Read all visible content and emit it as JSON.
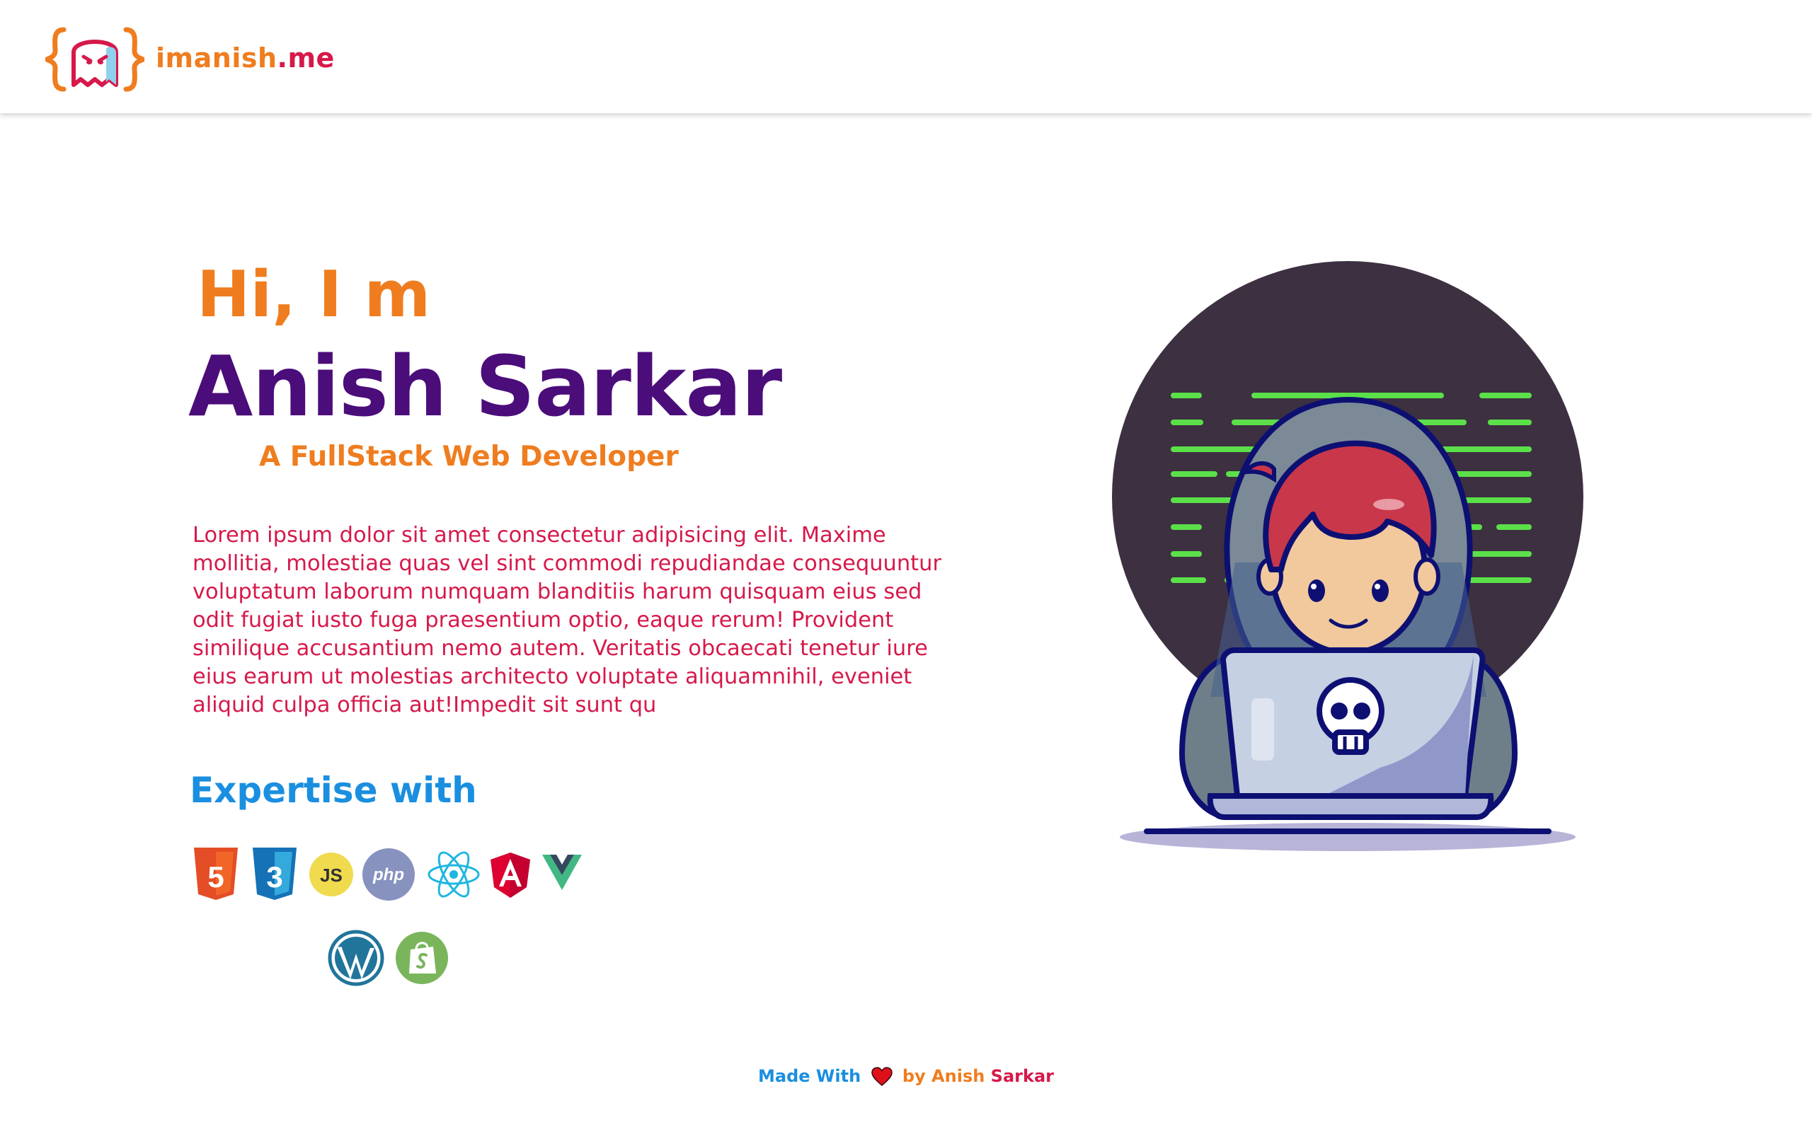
{
  "header": {
    "brand_part1": "imanish",
    "brand_part2": ".me"
  },
  "hero": {
    "greeting": "Hi, I m",
    "name": "Anish Sarkar",
    "role": "A FullStack Web Developer",
    "bio": "Lorem ipsum dolor sit amet consectetur adipisicing elit. Maxime mollitia, molestiae quas vel sint commodi repudiandae consequuntur voluptatum laborum numquam blanditiis harum quisquam eius sed odit fugiat iusto fuga praesentium optio, eaque rerum! Provident similique accusantium nemo autem. Veritatis obcaecati tenetur iure eius earum ut molestias architecto voluptate aliquamnihil, eveniet aliquid culpa officia aut!Impedit sit sunt qu"
  },
  "expertise": {
    "title": "Expertise with",
    "icons": [
      "html5-icon",
      "css3-icon",
      "javascript-icon",
      "php-icon",
      "react-icon",
      "angular-icon",
      "vue-icon",
      "wordpress-icon",
      "shopify-icon"
    ],
    "labels": {
      "html": "5",
      "css": "3",
      "js": "JS",
      "php": "php"
    }
  },
  "footer": {
    "made_with": "Made With",
    "by": "by Anish",
    "surname": "Sarkar"
  },
  "colors": {
    "orange": "#ef7d1f",
    "crimson": "#d6194a",
    "purple": "#4b0d7a",
    "blue": "#1a8fe0"
  }
}
